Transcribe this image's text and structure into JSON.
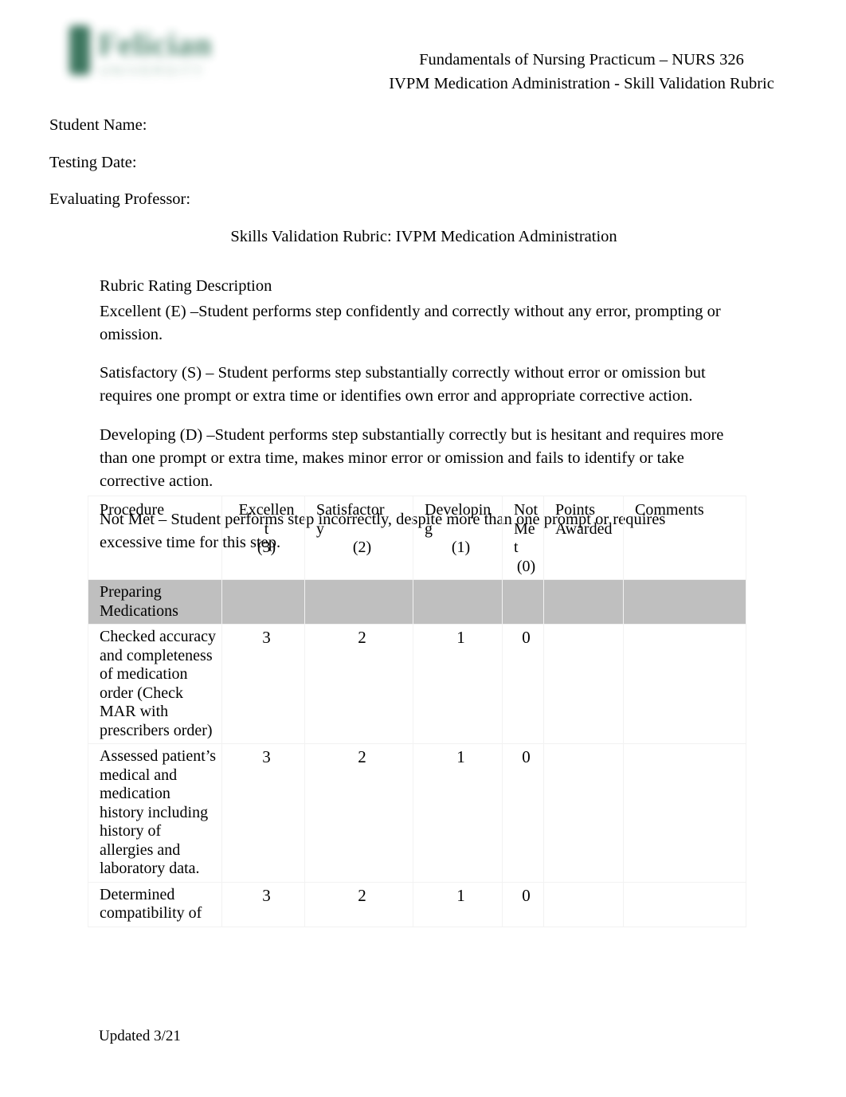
{
  "header": {
    "logo": {
      "name": "Felician",
      "subtitle": "UNIVERSITY",
      "color": "#2d6b52"
    },
    "course_line": "Fundamentals of Nursing Practicum – NURS 326",
    "document_line": "IVPM Medication Administration - Skill Validation Rubric"
  },
  "info": {
    "student_name_label": "Student Name:",
    "testing_date_label": "Testing Date:",
    "evaluating_professor_label": "Evaluating Professor:"
  },
  "subtitle": "Skills Validation Rubric: IVPM Medication Administration",
  "rubric_description": {
    "heading": "Rubric Rating Description",
    "excellent": "Excellent (E) –Student performs step confidently and correctly without any error, prompting or omission.",
    "satisfactory": "Satisfactory (S) – Student performs step substantially correctly without error or omission but requires one prompt or extra time or identifies own error and appropriate corrective action.",
    "developing": "Developing (D) –Student performs step substantially correctly but is hesitant and requires more than one prompt or extra time, makes minor error or omission and fails to identify or take corrective action.",
    "not_met": "Not Met – Student performs step incorrectly, despite more than one prompt or requires excessive time for this step."
  },
  "table": {
    "headers": {
      "procedure": "Procedure",
      "excellent_line1": "Excellen",
      "excellent_line2": "t",
      "excellent_score": "(3)",
      "satisfactory_line1": "Satisfactor",
      "satisfactory_line2": "y",
      "satisfactory_score": "(2)",
      "developing_line1": "Developin",
      "developing_line2": "g",
      "developing_score": "(1)",
      "not_met_line1": "Not",
      "not_met_line2": "Me",
      "not_met_line3": "t",
      "not_met_score": "(0)",
      "points_awarded": "Points Awarded",
      "comments": "Comments"
    },
    "section_row": "Preparing Medications",
    "rows": [
      {
        "procedure": "Checked accuracy and completeness of medication order (Check MAR with prescribers order)",
        "excellent": "3",
        "satisfactory": "2",
        "developing": "1",
        "not_met": "0",
        "points_awarded": "",
        "comments": ""
      },
      {
        "procedure": "Assessed patient’s medical and medication history including history of allergies and laboratory data.",
        "excellent": "3",
        "satisfactory": "2",
        "developing": "1",
        "not_met": "0",
        "points_awarded": "",
        "comments": ""
      },
      {
        "procedure": "Determined compatibility of",
        "excellent": "3",
        "satisfactory": "2",
        "developing": "1",
        "not_met": "0",
        "points_awarded": "",
        "comments": ""
      }
    ]
  },
  "footer": {
    "updated": "Updated 3/21"
  }
}
